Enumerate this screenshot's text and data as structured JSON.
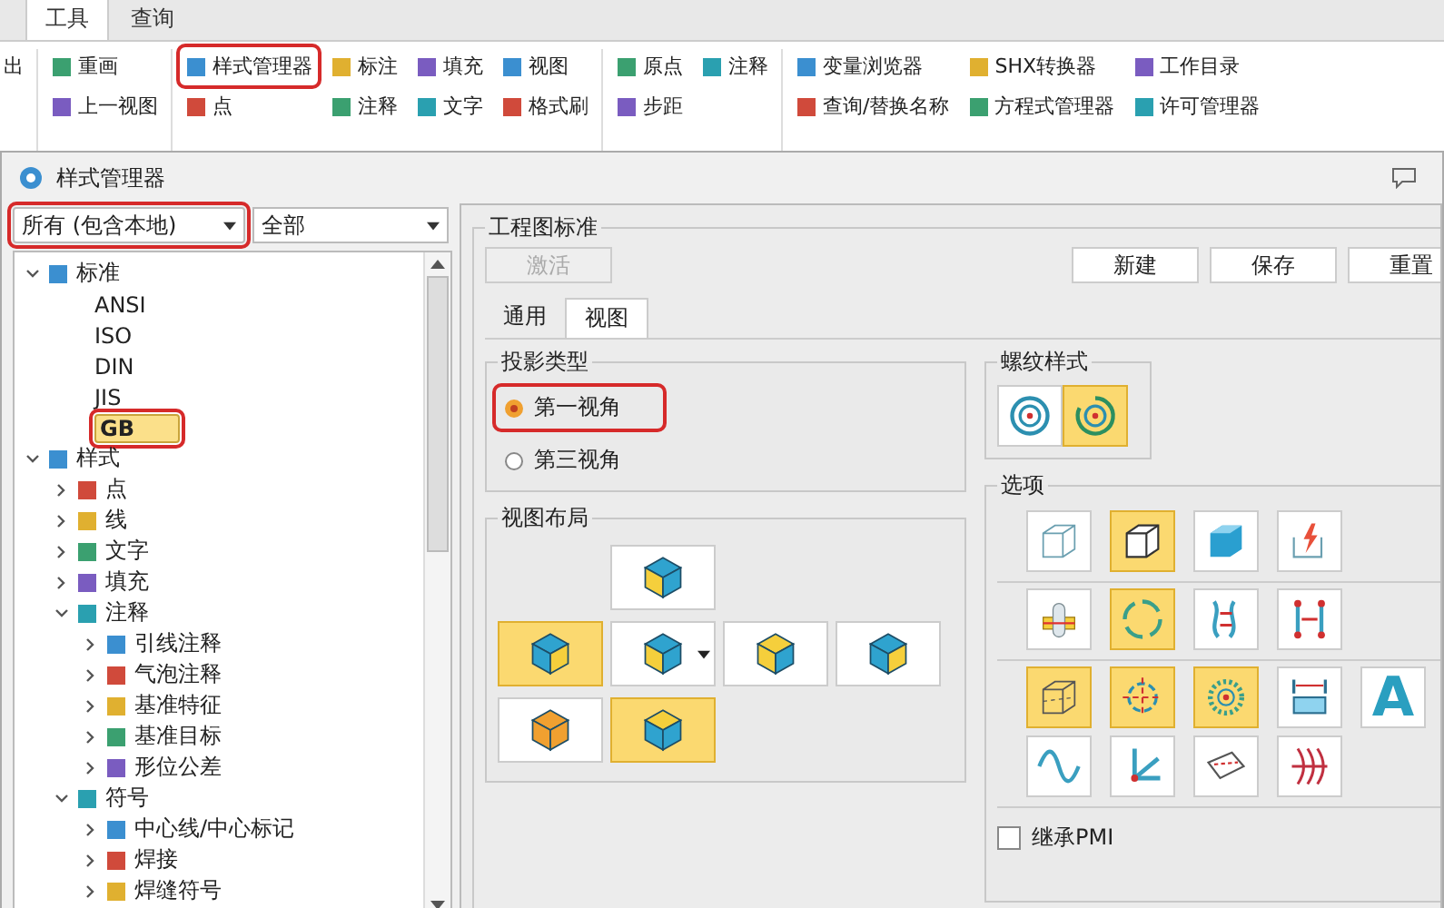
{
  "ribbon": {
    "tabs": [
      {
        "label": "工具",
        "selected": true
      },
      {
        "label": "查询",
        "selected": false
      }
    ],
    "groups": [
      {
        "columns": [
          [
            {
              "label": "出"
            }
          ]
        ]
      },
      {
        "columns": [
          [
            {
              "label": "重画"
            },
            {
              "label": "上一视图"
            }
          ]
        ]
      },
      {
        "columns": [
          [
            {
              "label": "样式管理器",
              "highlighted": true
            },
            {
              "label": "点"
            }
          ],
          [
            {
              "label": "标注"
            },
            {
              "label": "注释"
            }
          ],
          [
            {
              "label": "填充"
            },
            {
              "label": "文字"
            }
          ],
          [
            {
              "label": "视图"
            },
            {
              "label": "格式刷"
            }
          ]
        ]
      },
      {
        "columns": [
          [
            {
              "label": "原点"
            },
            {
              "label": "步距"
            }
          ],
          [
            {
              "label": "注释"
            }
          ]
        ]
      },
      {
        "columns": [
          [
            {
              "label": "变量浏览器"
            },
            {
              "label": "查询/替换名称"
            }
          ],
          [
            {
              "label": "SHX转换器"
            },
            {
              "label": "方程式管理器"
            }
          ],
          [
            {
              "label": "工作目录"
            },
            {
              "label": "许可管理器"
            }
          ]
        ]
      }
    ]
  },
  "dialog": {
    "title": "样式管理器",
    "filters": [
      {
        "value": "所有 (包含本地)",
        "highlighted": true
      },
      {
        "value": "全部"
      }
    ],
    "tree": [
      {
        "label": "标准",
        "expanded": true,
        "selected": false,
        "children": [
          {
            "label": "ANSI",
            "selected": false
          },
          {
            "label": "ISO",
            "selected": false
          },
          {
            "label": "DIN",
            "selected": false
          },
          {
            "label": "JIS",
            "selected": false
          },
          {
            "label": "GB",
            "selected": true,
            "highlighted": true
          }
        ]
      },
      {
        "label": "样式",
        "expanded": true,
        "selected": false,
        "children": [
          {
            "label": "点",
            "expanded": false,
            "selected": false
          },
          {
            "label": "线",
            "expanded": false,
            "selected": false
          },
          {
            "label": "文字",
            "expanded": false,
            "selected": false
          },
          {
            "label": "填充",
            "expanded": false,
            "selected": false
          },
          {
            "label": "注释",
            "expanded": true,
            "selected": false,
            "children": [
              {
                "label": "引线注释",
                "expanded": false,
                "selected": false
              },
              {
                "label": "气泡注释",
                "expanded": false,
                "selected": false
              },
              {
                "label": "基准特征",
                "expanded": false,
                "selected": false
              },
              {
                "label": "基准目标",
                "expanded": false,
                "selected": false
              },
              {
                "label": "形位公差",
                "expanded": false,
                "selected": false
              }
            ]
          },
          {
            "label": "符号",
            "expanded": true,
            "selected": false,
            "children": [
              {
                "label": "中心线/中心标记",
                "expanded": false,
                "selected": false
              },
              {
                "label": "焊接",
                "expanded": false,
                "selected": false
              },
              {
                "label": "焊缝符号",
                "expanded": false,
                "selected": false
              }
            ]
          }
        ]
      }
    ],
    "standard": {
      "title": "工程图标准",
      "buttons": [
        {
          "label": "激活",
          "disabled": true
        },
        {
          "label": "新建",
          "disabled": false
        },
        {
          "label": "保存",
          "disabled": false
        },
        {
          "label": "重置",
          "disabled": false
        }
      ],
      "tabs": [
        {
          "label": "通用",
          "selected": false
        },
        {
          "label": "视图",
          "selected": true
        }
      ],
      "projection": {
        "title": "投影类型",
        "options": [
          {
            "label": "第一视角",
            "selected": true,
            "highlighted": true
          },
          {
            "label": "第三视角",
            "selected": false
          }
        ]
      },
      "view_layout": {
        "title": "视图布局",
        "buttons": [
          {
            "selected": false
          },
          {
            "selected": true
          },
          {
            "selected": false
          },
          {
            "selected": false
          },
          {
            "selected": false
          },
          {
            "selected": false
          },
          {
            "selected": true
          }
        ]
      },
      "thread_style": {
        "title": "螺纹样式",
        "buttons": [
          {
            "selected": false
          },
          {
            "selected": true
          }
        ]
      },
      "options": {
        "title": "选项",
        "sections": [
          {
            "buttons": [
              {
                "selected": false
              },
              {
                "selected": true
              },
              {
                "selected": false
              },
              {
                "selected": false
              }
            ]
          },
          {
            "buttons": [
              {
                "selected": false
              },
              {
                "selected": true
              },
              {
                "selected": false
              },
              {
                "selected": false
              }
            ]
          },
          {
            "buttons": [
              {
                "selected": true
              },
              {
                "selected": true
              },
              {
                "selected": true
              },
              {
                "selected": false
              },
              {
                "selected": false,
                "glyph": "A"
              },
              {
                "selected": false
              },
              {
                "selected": false
              },
              {
                "selected": false
              },
              {
                "selected": false
              }
            ]
          }
        ],
        "inherit_pmi": {
          "label": "继承PMI",
          "checked": false
        }
      }
    }
  }
}
